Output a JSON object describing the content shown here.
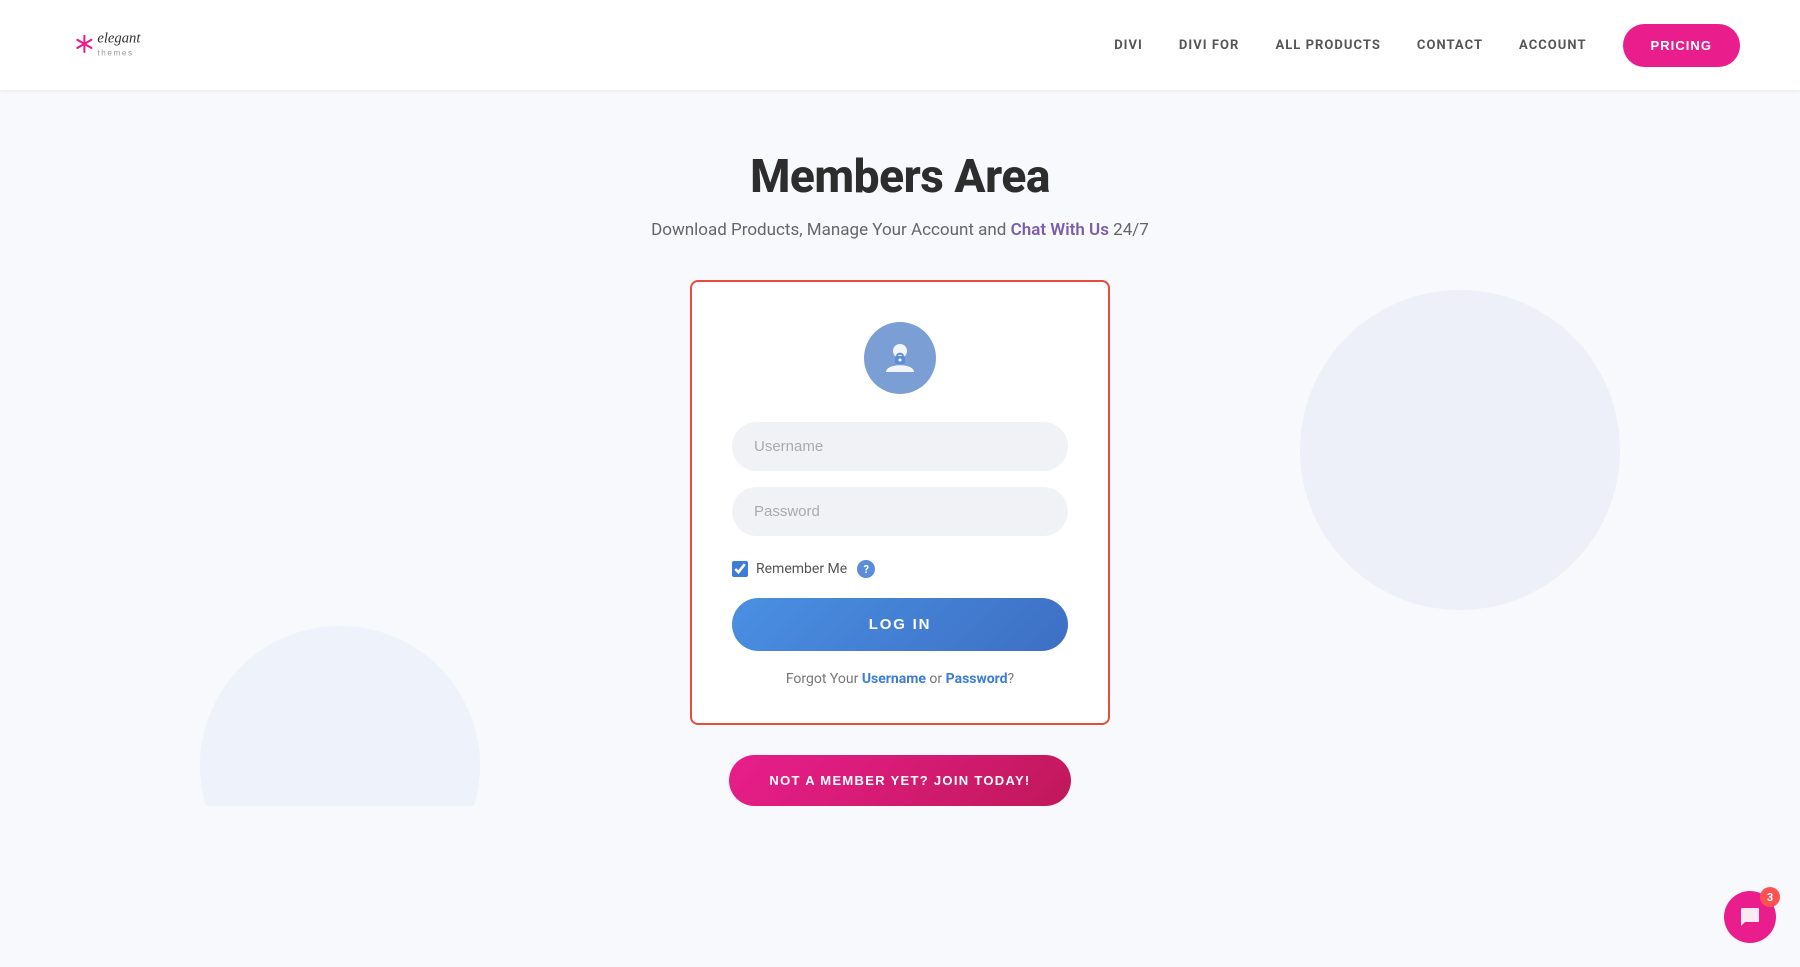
{
  "header": {
    "logo_alt": "Elegant Themes",
    "nav": {
      "items": [
        {
          "label": "DIVI",
          "id": "divi"
        },
        {
          "label": "DIVI FOR",
          "id": "divi-for"
        },
        {
          "label": "ALL PRODUCTS",
          "id": "all-products"
        },
        {
          "label": "CONTACT",
          "id": "contact"
        },
        {
          "label": "ACCOUNT",
          "id": "account"
        }
      ],
      "pricing_label": "PRICING"
    }
  },
  "main": {
    "page_title": "Members Area",
    "subtitle_text": "Download Products, Manage Your Account and ",
    "subtitle_link": "Chat With Us",
    "subtitle_suffix": " 24/7",
    "login_card": {
      "username_placeholder": "Username",
      "password_placeholder": "Password",
      "remember_label": "Remember Me",
      "help_icon": "?",
      "login_button_label": "LOG IN",
      "forgot_prefix": "Forgot Your ",
      "forgot_username": "Username",
      "forgot_or": " or ",
      "forgot_password": "Password",
      "forgot_suffix": "?"
    },
    "join_button_label": "NOT A MEMBER YET? JOIN TODAY!"
  },
  "chat": {
    "badge_count": "3",
    "icon": "💬"
  }
}
